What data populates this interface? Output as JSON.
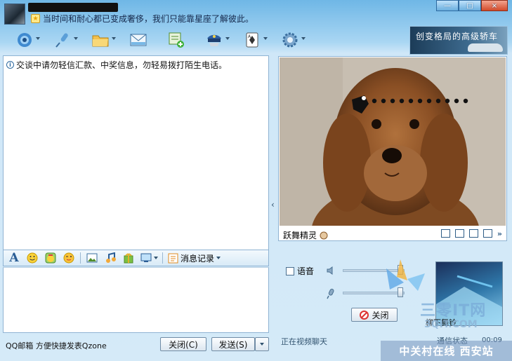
{
  "header": {
    "signature": "当时间和耐心都已变成奢侈，我们只能靠星座了解彼此。",
    "window_buttons": [
      "—",
      "□",
      "×"
    ]
  },
  "toolbar": {
    "items": [
      "video-chat",
      "voice-chat",
      "send-file",
      "send-mail",
      "create-discussion-group",
      "remote-assist",
      "apps",
      "settings"
    ]
  },
  "ad": {
    "text": "创变格局的高级轿车"
  },
  "chat": {
    "notice": "交谈中请勿轻信汇款、中奖信息，勿轻易拨打陌生电话。"
  },
  "edit_toolbar": {
    "history_label": "消息记录"
  },
  "bottom": {
    "qzone_text": "QQ邮箱 方便快捷发表Qzone",
    "close_label": "关闭(C)",
    "send_label": "发送(S)"
  },
  "video": {
    "effect_label": "跃舞精灵",
    "voice_label": "语音",
    "close_label": "关闭",
    "preview_label": "柳下舞铃",
    "preview_status": "通信状态",
    "timer": "00:09",
    "status_text": "正在视频聊天"
  },
  "watermark": {
    "brand_cn": "三零IT网",
    "brand_url": "3QIT.COM",
    "station": "中关村在线 西安站"
  },
  "colors": {
    "accent": "#2e6aa0",
    "window_bg": "#cfe6f7"
  }
}
